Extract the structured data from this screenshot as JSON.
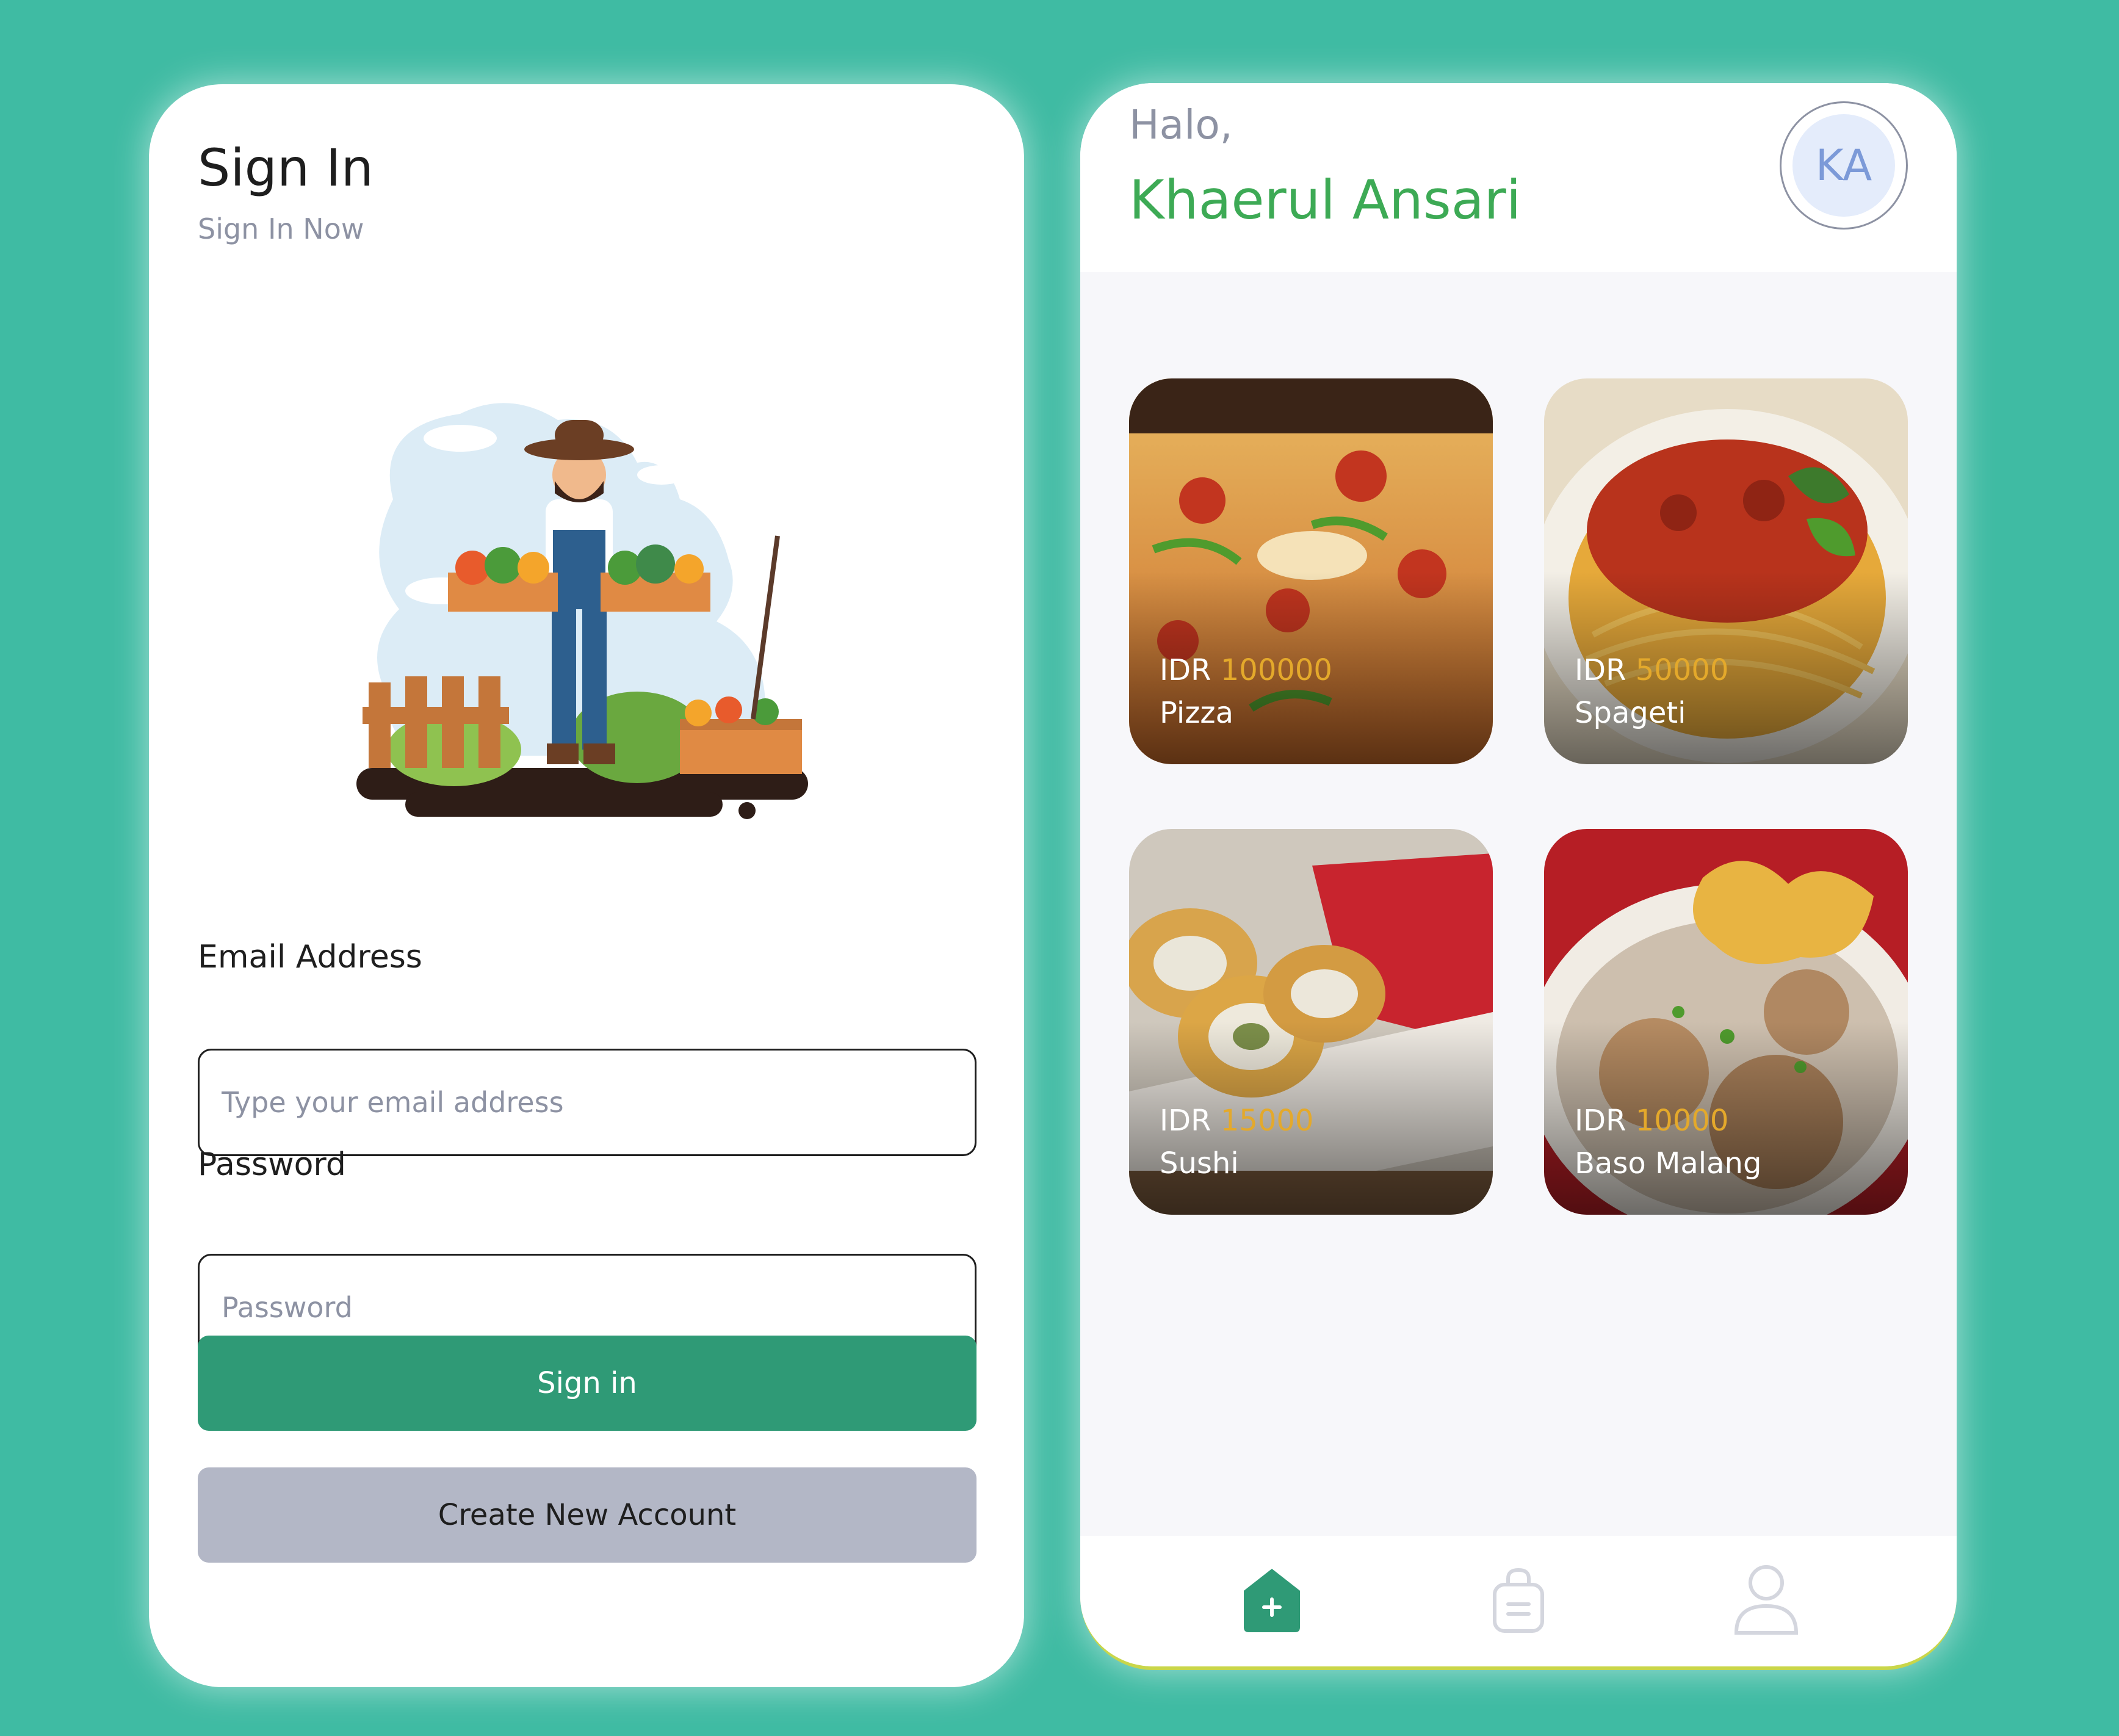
{
  "signin": {
    "title": "Sign In",
    "subtitle": "Sign In Now",
    "email_label": "Email Address",
    "email_placeholder": "Type your email address",
    "email_value": "",
    "password_label": "Password",
    "password_placeholder": "Password",
    "password_value": "",
    "signin_button": "Sign in",
    "create_button": "Create New Account"
  },
  "home": {
    "greeting": "Halo,",
    "user_name": "Khaerul Ansari",
    "avatar_initials": "KA",
    "currency": "IDR",
    "foods": [
      {
        "name": "Pizza",
        "price": "100000"
      },
      {
        "name": "Spageti",
        "price": "50000"
      },
      {
        "name": "Sushi",
        "price": "15000"
      },
      {
        "name": "Baso Malang",
        "price": "10000"
      }
    ],
    "nav": [
      "home-icon",
      "orders-icon",
      "profile-icon"
    ]
  },
  "colors": {
    "background": "#3fbba3",
    "primary": "#2f9a76",
    "accent_name": "#3daa55",
    "price": "#e4a92b",
    "secondary_button": "#b3b7c6"
  }
}
